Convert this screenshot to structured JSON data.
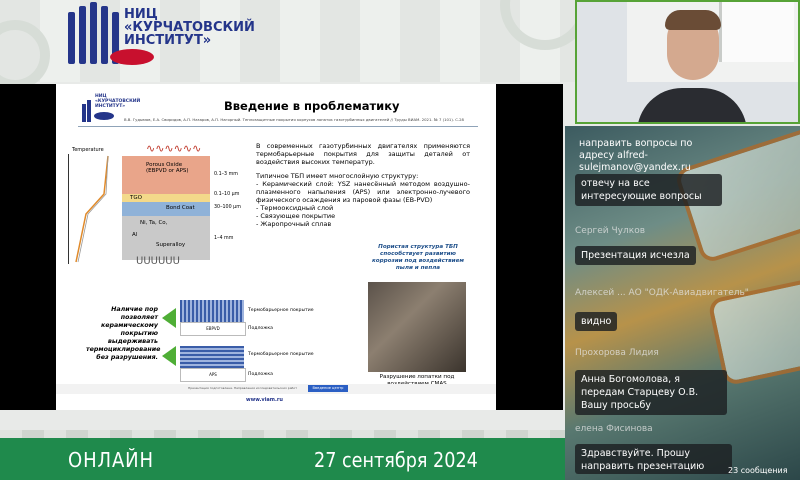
{
  "header": {
    "org_name": "НИЦ\n«КУРЧАТОВСКИЙ\nИНСТИТУТ»"
  },
  "slide": {
    "title": "Введение в проблематику",
    "authors": "В.В. Гудымов, Е.А. Свиридов, А.П. Назаров, А.П. Нагорный. Теплозащитные покрытия корпусов лопаток газотурбинных двигателей // Труды ВИАМ. 2021. № 7 (101). С.28",
    "mini_logo": "НИЦ\n«КУРЧАТОВСКИЙ\nИНСТИТУТ»",
    "temperature_label": "Temperature",
    "layers": {
      "porous_oxide": "Porous Oxide\n(EBPVD or APS)",
      "tgo": "TGO",
      "bond_coat": "Bond Coat",
      "ni_ta": "Ni, Ta, Co,",
      "al": "Al",
      "superalloy": "Superalloy"
    },
    "dims": [
      "0.1–3 mm",
      "0.1–10 μm",
      "30–100 μm",
      "1–4 mm"
    ],
    "intro_text": "В современных газотурбинных двигателях применяются термобарьерные покрытия для защиты деталей от воздействия высоких температур.",
    "structure_heading": "Типичное ТБП имеет многослойную структуру:",
    "structure_items": [
      "- Керамический слой: YSZ нанесённый методом воздушно-плазменного напыления (APS) или электронно-лучевого физического осаждения из паровой фазы (EB-PVD)",
      "- Термооксидный слой",
      "- Связующее покрытие",
      "- Жаропрочный сплав"
    ],
    "porous_note": "Пористая структура ТБП способствует развитию коррозии под воздействием пыли и пепла",
    "arrow_note": "Наличие пор позволяет керамическому покрытию выдерживать термоциклирование без разрушения.",
    "micro": [
      {
        "label": "EBPVD",
        "coat": "Термобарьерное покрытие",
        "sub": "Подложка"
      },
      {
        "label": "APS",
        "coat": "Термобарьерное покрытие",
        "sub": "Подложка"
      }
    ],
    "blade_caption": "Разрушение лопатки под воздействием CMAS",
    "footer_button": "Введение центр",
    "footer_url": "www.viam.ru",
    "footer_small": "Презентация подготовлена. Направления исследовательских работ"
  },
  "chat": {
    "messages": [
      {
        "sender": "",
        "text": "направить вопросы по адресу alfred-sulejmanov@yandex.ru"
      },
      {
        "sender": "",
        "text": "отвечу на все интересующие вопросы"
      },
      {
        "sender": "Сергей Чулков",
        "text": "Презентация исчезла"
      },
      {
        "sender": "Алексей ... АО \"ОДК-Авиадвигатель\"",
        "text": "видно"
      },
      {
        "sender": "Прохорова Лидия",
        "text": "Анна Богомолова, я передам Старцеву О.В. Вашу просьбу"
      },
      {
        "sender": "елена Фисинова",
        "text": "Здравствуйте. Прошу направить презентацию К.В.Сухаревой на почту:lena.fisinova@yandex..."
      }
    ],
    "more_count": "23 сообщения"
  },
  "bottom": {
    "online_label": "ОНЛАЙН",
    "date": "27 сентября 2024"
  },
  "colors": {
    "brand_blue": "#24358a",
    "brand_green": "#1f8a4c",
    "accent_red": "#c8102e",
    "webcam_border": "#57a337"
  }
}
